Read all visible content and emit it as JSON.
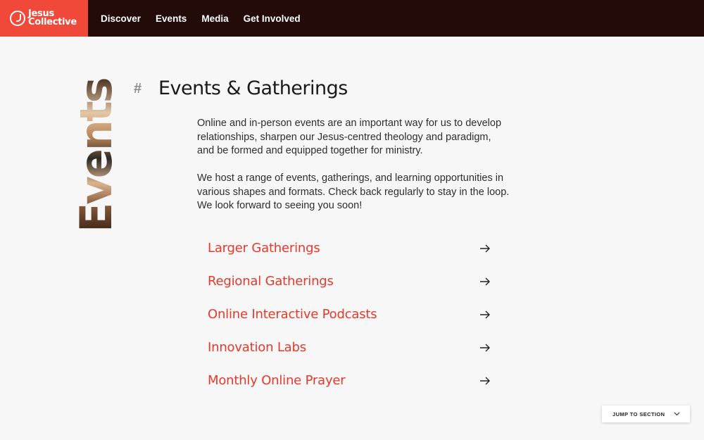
{
  "header": {
    "logo_line1": "Jesus",
    "logo_line2": "Collective",
    "nav": [
      "Discover",
      "Events",
      "Media",
      "Get Involved"
    ]
  },
  "section": {
    "vertical_word": "Events",
    "hash": "#",
    "title": "Events & Gatherings",
    "paragraphs": [
      "Online and in-person events are an important way for us to develop relationships, sharpen our Jesus-centred theology and paradigm, and be formed and equipped together for ministry.",
      "We host a range of events, gatherings, and learning opportunities in various shapes and formats. Check back regularly to stay in the loop. We look forward to seeing you soon!"
    ],
    "links": [
      "Larger Gatherings",
      "Regional Gatherings",
      "Online Interactive Podcasts",
      "Innovation Labs",
      "Monthly Online Prayer"
    ]
  },
  "jump": {
    "label": "JUMP TO SECTION",
    "icon": "chevron-down-icon"
  },
  "colors": {
    "header_bg": "#220b08",
    "brand": "#f0493a",
    "link": "#e6392b",
    "page_bg": "#f7f7f7"
  }
}
